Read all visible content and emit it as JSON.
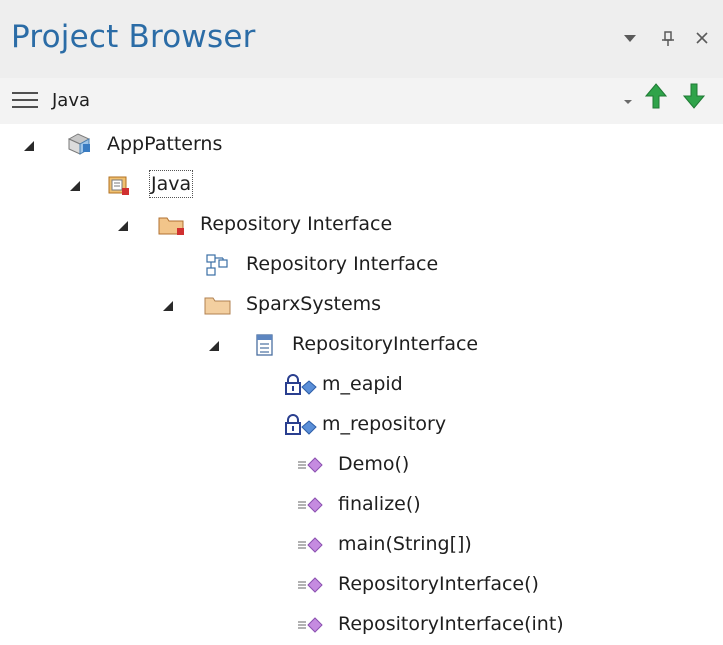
{
  "window": {
    "title": "Project Browser",
    "controls": [
      "chevron-down-icon",
      "pin-icon",
      "close-icon"
    ]
  },
  "toolbar": {
    "menu_icon": "hamburger-menu-icon",
    "current_package": "Java",
    "nav": [
      "move-up-arrow-icon",
      "move-down-arrow-icon"
    ]
  },
  "colors": {
    "title_blue": "#2b6ca6",
    "arrow_green": "#2fa34a",
    "titlebar_bg": "#eeeeee",
    "toolbar_bg": "#f3f3f3"
  },
  "tree": {
    "nodes": [
      {
        "label": "AppPatterns",
        "icon": "model-root-icon",
        "expanded": true
      },
      {
        "label": "Java",
        "icon": "view-package-icon",
        "expanded": true,
        "selected": true
      },
      {
        "label": "Repository Interface",
        "icon": "package-folder-icon",
        "expanded": true
      },
      {
        "label": "Repository Interface",
        "icon": "class-diagram-icon"
      },
      {
        "label": "SparxSystems",
        "icon": "folder-icon",
        "expanded": true
      },
      {
        "label": "RepositoryInterface",
        "icon": "class-icon",
        "expanded": true
      },
      {
        "label": "m_eapid",
        "icon": "private-attribute-icon"
      },
      {
        "label": "m_repository",
        "icon": "private-attribute-icon"
      },
      {
        "label": "Demo()",
        "icon": "public-operation-icon"
      },
      {
        "label": "finalize()",
        "icon": "public-operation-icon"
      },
      {
        "label": "main(String[])",
        "icon": "public-operation-icon"
      },
      {
        "label": "RepositoryInterface()",
        "icon": "public-operation-icon"
      },
      {
        "label": "RepositoryInterface(int)",
        "icon": "public-operation-icon"
      }
    ]
  }
}
